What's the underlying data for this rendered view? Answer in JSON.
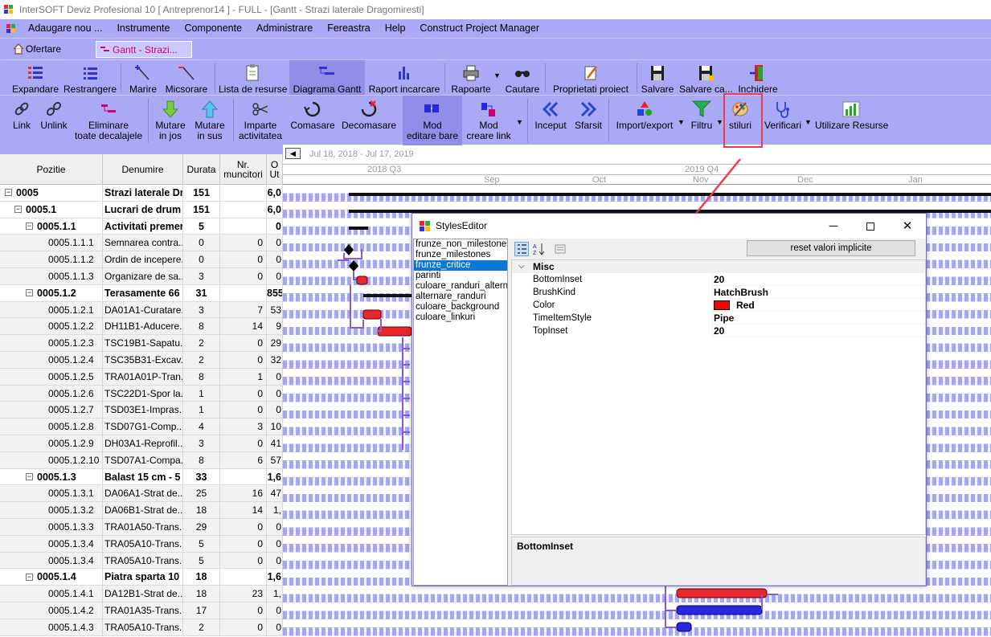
{
  "window": {
    "title": "InterSOFT Deviz Profesional 10 [ Antreprenor14 ] - FULL - [Gantt - Strazi laterale Dragomiresti]"
  },
  "menu": [
    "Adaugare nou ...",
    "Instrumente",
    "Componente",
    "Administrare",
    "Fereastra",
    "Help",
    "Construct Project Manager"
  ],
  "tabs": {
    "ofertare": "Ofertare",
    "gantt": "Gantt - Strazi..."
  },
  "toolbar1": {
    "expandare": "Expandare",
    "restrangere": "Restrangere",
    "marire": "Marire",
    "micsorare": "Micsorare",
    "lista_resurse": "Lista de resurse",
    "diagrama_gantt": "Diagrama Gantt",
    "raport_incarcare": "Raport incarcare",
    "rapoarte": "Rapoarte",
    "cautare": "Cautare",
    "proprietati": "Proprietati proiect",
    "salvare": "Salvare",
    "salvare_ca": "Salvare ca...",
    "inchidere": "Inchidere"
  },
  "toolbar2": {
    "link": "Link",
    "unlink": "Unlink",
    "eliminare_1": "Eliminare",
    "eliminare_2": "toate decalajele",
    "mutare_jos_1": "Mutare",
    "mutare_jos_2": "in jos",
    "mutare_sus_1": "Mutare",
    "mutare_sus_2": "in sus",
    "imparte_1": "Imparte",
    "imparte_2": "activitatea",
    "comasare": "Comasare",
    "decomasare": "Decomasare",
    "mod_editare_1": "Mod",
    "mod_editare_2": "editare bare",
    "mod_creare_1": "Mod",
    "mod_creare_2": "creare link",
    "inceput": "Inceput",
    "sfarsit": "Sfarsit",
    "import_export": "Import/export",
    "filtru": "Filtru",
    "stiluri": "stiluri",
    "verificari": "Verificari",
    "utilizare_resurse": "Utilizare Resurse"
  },
  "grid": {
    "headers": {
      "pozitie": "Pozitie",
      "denumire": "Denumire",
      "durata": "Durata",
      "nr1": "Nr.",
      "nr2": "muncitori",
      "o1": "O",
      "o2": "Ut"
    },
    "rows": [
      {
        "poz": "0005",
        "den": "Strazi laterale Dr",
        "dur": "151",
        "nr": "",
        "o": "6,0",
        "lvl": 0
      },
      {
        "poz": "0005.1",
        "den": "Lucrari de drum",
        "dur": "151",
        "nr": "",
        "o": "6,0",
        "lvl": 1
      },
      {
        "poz": "0005.1.1",
        "den": "Activitati premer",
        "dur": "5",
        "nr": "",
        "o": "0",
        "lvl": 2
      },
      {
        "poz": "0005.1.1.1",
        "den": "Semnarea contra...",
        "dur": "0",
        "nr": "0",
        "o": "0",
        "lvl": 3
      },
      {
        "poz": "0005.1.1.2",
        "den": "Ordin de incepere...",
        "dur": "0",
        "nr": "0",
        "o": "0",
        "lvl": 3
      },
      {
        "poz": "0005.1.1.3",
        "den": "Organizare de sa...",
        "dur": "3",
        "nr": "0",
        "o": "0",
        "lvl": 3
      },
      {
        "poz": "0005.1.2",
        "den": "Terasamente 66",
        "dur": "31",
        "nr": "",
        "o": "855",
        "lvl": 2
      },
      {
        "poz": "0005.1.2.1",
        "den": "DA01A1-Curatare...",
        "dur": "3",
        "nr": "7",
        "o": "53",
        "lvl": 3
      },
      {
        "poz": "0005.1.2.2",
        "den": "DH11B1-Aducere...",
        "dur": "8",
        "nr": "14",
        "o": "9",
        "lvl": 3
      },
      {
        "poz": "0005.1.2.3",
        "den": "TSC19B1-Sapatu...",
        "dur": "2",
        "nr": "0",
        "o": "29",
        "lvl": 3
      },
      {
        "poz": "0005.1.2.4",
        "den": "TSC35B31-Excav...",
        "dur": "2",
        "nr": "0",
        "o": "32",
        "lvl": 3
      },
      {
        "poz": "0005.1.2.5",
        "den": "TRA01A01P-Tran...",
        "dur": "8",
        "nr": "1",
        "o": "0",
        "lvl": 3
      },
      {
        "poz": "0005.1.2.6",
        "den": "TSC22D1-Spor la...",
        "dur": "1",
        "nr": "0",
        "o": "0",
        "lvl": 3
      },
      {
        "poz": "0005.1.2.7",
        "den": "TSD03E1-Impras...",
        "dur": "1",
        "nr": "0",
        "o": "0",
        "lvl": 3
      },
      {
        "poz": "0005.1.2.8",
        "den": "TSD07G1-Comp...",
        "dur": "4",
        "nr": "3",
        "o": "10",
        "lvl": 3
      },
      {
        "poz": "0005.1.2.9",
        "den": "DH03A1-Reprofil...",
        "dur": "3",
        "nr": "0",
        "o": "41",
        "lvl": 3
      },
      {
        "poz": "0005.1.2.10",
        "den": "TSD07A1-Compa...",
        "dur": "8",
        "nr": "6",
        "o": "57",
        "lvl": 3
      },
      {
        "poz": "0005.1.3",
        "den": "Balast 15 cm - 5",
        "dur": "33",
        "nr": "",
        "o": "1,6",
        "lvl": 2
      },
      {
        "poz": "0005.1.3.1",
        "den": "DA06A1-Strat de...",
        "dur": "25",
        "nr": "16",
        "o": "47",
        "lvl": 3
      },
      {
        "poz": "0005.1.3.2",
        "den": "DA06B1-Strat de...",
        "dur": "18",
        "nr": "14",
        "o": "1,",
        "lvl": 3
      },
      {
        "poz": "0005.1.3.3",
        "den": "TRA01A50-Trans...",
        "dur": "29",
        "nr": "0",
        "o": "0",
        "lvl": 3
      },
      {
        "poz": "0005.1.3.4",
        "den": "TRA05A10-Trans...",
        "dur": "5",
        "nr": "0",
        "o": "0",
        "lvl": 3
      },
      {
        "poz": "0005.1.3.4",
        "den": "TRA05A10-Trans...",
        "dur": "5",
        "nr": "0",
        "o": "0",
        "lvl": 3
      },
      {
        "poz": "0005.1.4",
        "den": "Piatra sparta 10",
        "dur": "18",
        "nr": "",
        "o": "1,6",
        "lvl": 2
      },
      {
        "poz": "0005.1.4.1",
        "den": "DA12B1-Strat de...",
        "dur": "18",
        "nr": "23",
        "o": "1,",
        "lvl": 3
      },
      {
        "poz": "0005.1.4.2",
        "den": "TRA01A35-Trans...",
        "dur": "17",
        "nr": "0",
        "o": "0",
        "lvl": 3
      },
      {
        "poz": "0005.1.4.3",
        "den": "TRA05A10-Trans...",
        "dur": "2",
        "nr": "0",
        "o": "0",
        "lvl": 3
      }
    ]
  },
  "gantt": {
    "date_range": "Jul 18, 2018 - Jul 17, 2019",
    "quarter1": "2018 Q3",
    "quarter2": "2019 Q4",
    "months": [
      "Sep",
      "Oct",
      "Nov",
      "Dec",
      "Jan"
    ]
  },
  "dialog": {
    "title": "StylesEditor",
    "reset": "reset valori implicite",
    "list": [
      "frunze_non_milestones",
      "frunze_milestones",
      "frunze_critice",
      "parinti",
      "culoare_randuri_alternare",
      "alternare_randuri",
      "culoare_background",
      "culoare_linkuri"
    ],
    "selected_index": 2,
    "category": "Misc",
    "properties": [
      {
        "name": "BottomInset",
        "value": "20"
      },
      {
        "name": "BrushKind",
        "value": "HatchBrush"
      },
      {
        "name": "Color",
        "value": "Red",
        "swatch": "#ff0000"
      },
      {
        "name": "TimeItemStyle",
        "value": "Pipe"
      },
      {
        "name": "TopInset",
        "value": "20"
      }
    ],
    "description": "BottomInset"
  },
  "colors": {
    "toolbar": "#a9a9f5",
    "highlight": "#ef3b4b",
    "selection": "#0a78d7",
    "critical_bar": "#e8282e",
    "normal_bar": "#2828e0"
  }
}
